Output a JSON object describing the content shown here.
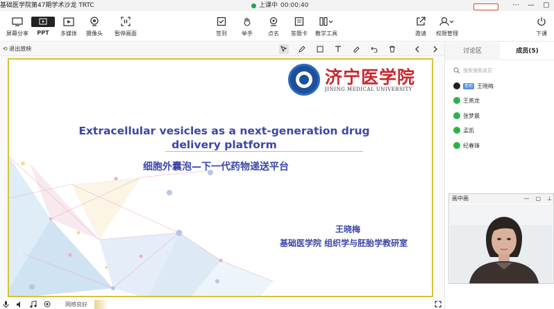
{
  "window": {
    "title": "基础医学院第47期学术沙龙 TRTC",
    "live_status": "上课中",
    "timer": "00:00:40"
  },
  "toolbar": {
    "left": [
      {
        "label": "屏幕分享",
        "icon": "screen-share-icon"
      },
      {
        "label": "PPT",
        "icon": "ppt-icon"
      },
      {
        "label": "多媒体",
        "icon": "media-icon"
      },
      {
        "label": "摄像头",
        "icon": "camera-icon"
      },
      {
        "label": "暂停画面",
        "icon": "pause-screen-icon"
      }
    ],
    "center": [
      {
        "label": "签到",
        "icon": "checkin-icon"
      },
      {
        "label": "举手",
        "icon": "raise-hand-icon"
      },
      {
        "label": "点名",
        "icon": "rollcall-icon"
      },
      {
        "label": "答题卡",
        "icon": "answer-card-icon"
      },
      {
        "label": "教学工具",
        "icon": "teaching-tools-icon"
      }
    ],
    "right": [
      {
        "label": "邀请",
        "icon": "invite-icon"
      },
      {
        "label": "权限管理",
        "icon": "permission-icon"
      },
      {
        "label": "下课",
        "icon": "end-class-icon"
      }
    ]
  },
  "subbar": {
    "exit_label": "退出放映"
  },
  "slide": {
    "university_cn": "济宁医学院",
    "university_en": "JINING MEDICAL UNIVERSITY",
    "title_en": "Extracellular vesicles as a next-generation drug delivery platform",
    "title_cn": "细胞外囊泡—下一代药物递送平台",
    "author": "王晓梅",
    "department": "基础医学院  组织学与胚胎学教研室"
  },
  "statusbar": {
    "network": "网络良好"
  },
  "panel": {
    "tabs": [
      {
        "label": "讨论区"
      },
      {
        "label": "成员(5)"
      }
    ],
    "search_placeholder": "搜索搜索成员",
    "members": [
      {
        "name": "王晓梅",
        "role": "老师",
        "icon": "qq-avatar-icon"
      },
      {
        "name": "王燕龙",
        "role": "",
        "icon": "wechat-icon"
      },
      {
        "name": "张梦晨",
        "role": "",
        "icon": "wechat-icon"
      },
      {
        "name": "孟凯",
        "role": "",
        "icon": "wechat-icon"
      },
      {
        "name": "纪春锋",
        "role": "",
        "icon": "wechat-icon"
      }
    ]
  },
  "pip": {
    "title": "画中画"
  }
}
